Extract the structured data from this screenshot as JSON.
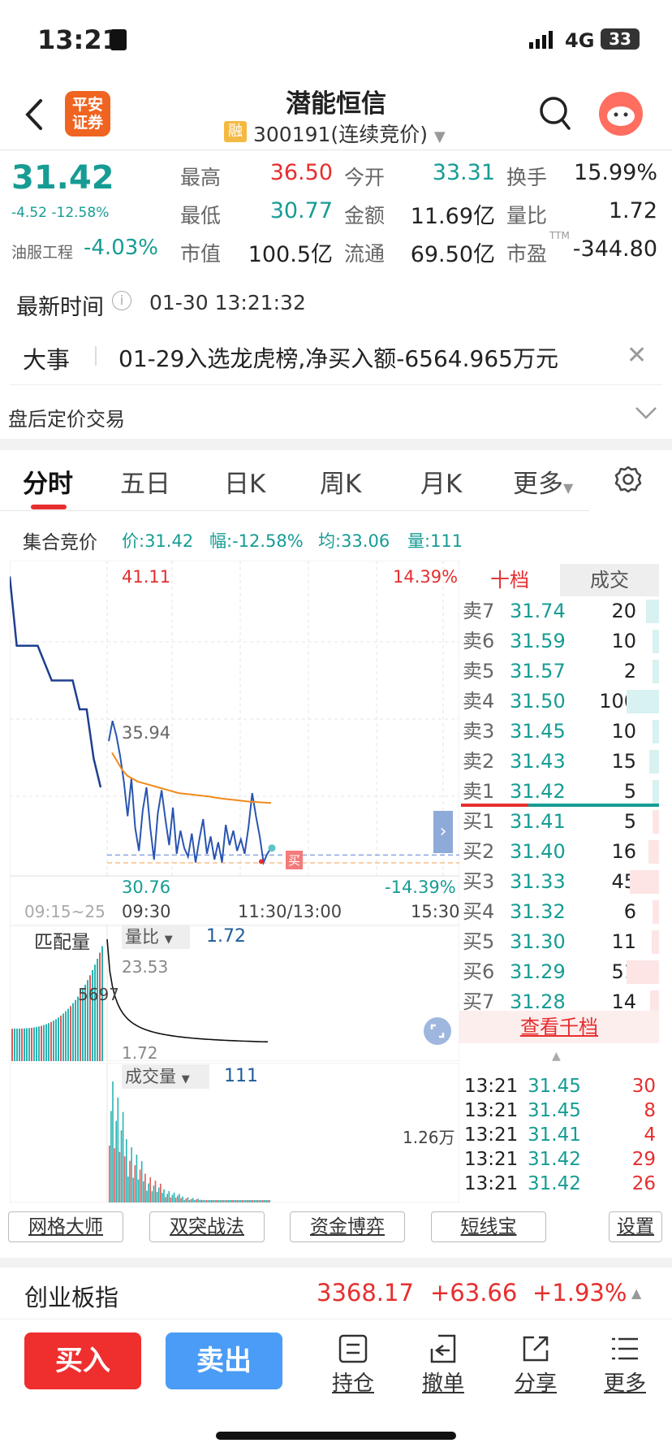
{
  "status": {
    "time": "13:21",
    "network": "4G",
    "battery": "33"
  },
  "header": {
    "title": "潜能恒信",
    "code_label": "300191(连续竞价)",
    "rong": "融",
    "broker_logo": "平安\n证券"
  },
  "quote": {
    "price": "31.42",
    "change": "-4.52 -12.58%",
    "industry_name": "油服工程",
    "industry_change": "-4.03%",
    "fields": [
      {
        "label": "最高",
        "value": "36.50",
        "color": "red"
      },
      {
        "label": "今开",
        "value": "33.31",
        "color": "green"
      },
      {
        "label": "换手",
        "value": "15.99%",
        "color": "black"
      },
      {
        "label": "最低",
        "value": "30.77",
        "color": "green"
      },
      {
        "label": "金额",
        "value": "11.69亿",
        "color": "black"
      },
      {
        "label": "量比",
        "value": "1.72",
        "color": "black"
      },
      {
        "label": "市值",
        "value": "100.5亿",
        "color": "black"
      },
      {
        "label": "流通",
        "value": "69.50亿",
        "color": "black"
      },
      {
        "label": "市盈",
        "value": "-344.80",
        "color": "black"
      }
    ],
    "ttm": "TTM"
  },
  "time_row": {
    "label": "最新时间",
    "value": "01-30 13:21:32"
  },
  "event": {
    "label": "大事",
    "text": "01-29入选龙虎榜,净买入额-6564.965万元"
  },
  "after_hours": {
    "label": "盘后定价交易"
  },
  "tabs": [
    "分时",
    "五日",
    "日K",
    "周K",
    "月K",
    "更多"
  ],
  "info_line": {
    "title": "集合竞价",
    "price": "价:31.42",
    "change": "幅:-12.58%",
    "avg": "均:33.06",
    "vol": "量:111"
  },
  "chart": {
    "max_price": "41.11",
    "max_pct": "14.39%",
    "min_price": "30.76",
    "min_pct": "-14.39%",
    "mid_price": "35.94",
    "buy_tag": "买",
    "x_labels": [
      "09:15~25",
      "09:30",
      "11:30/13:00",
      "15:30"
    ],
    "price_line": [
      35.2,
      35.9,
      35.4,
      34.7,
      33.8,
      32.6,
      33.9,
      32.2,
      31.4,
      32.8,
      33.6,
      32.2,
      31.1,
      32.7,
      33.5,
      32.5,
      31.6,
      32.9,
      31.3,
      32.1,
      31.5,
      31.2,
      32.0,
      31.0,
      31.8,
      32.5,
      31.3,
      31.9,
      31.1,
      31.7,
      31.0,
      32.3,
      31.6,
      32.1,
      31.4,
      31.8,
      31.3,
      32.2,
      33.4,
      32.6,
      31.9,
      31.0,
      31.3,
      31.5
    ],
    "avg_line": [
      34.8,
      34.5,
      34.2,
      34.0,
      33.9,
      33.8,
      33.75,
      33.7,
      33.65,
      33.6,
      33.55,
      33.5,
      33.45,
      33.4,
      33.38,
      33.36,
      33.34,
      33.32,
      33.3,
      33.28,
      33.25,
      33.22,
      33.2,
      33.18,
      33.16,
      33.14,
      33.12,
      33.1,
      33.09,
      33.08,
      33.07,
      33.06
    ],
    "auction_line": [
      40.9,
      38.5,
      38.5,
      38.5,
      38.5,
      37.9,
      37.3,
      37.3,
      37.3,
      37.3,
      36.3,
      36.3,
      34.6,
      33.6
    ]
  },
  "volume": {
    "match_title": "匹配量",
    "match_value": "5697",
    "ratio_label": "量比",
    "ratio_value": "1.72",
    "ratio_max": "23.53",
    "ratio_min": "1.72",
    "vol_label": "成交量",
    "vol_value": "111",
    "vol_max": "1.26万"
  },
  "orderbook": {
    "tab_levels": "十档",
    "tab_trades": "成交",
    "sells": [
      {
        "label": "卖7",
        "price": "31.74",
        "qty": "20"
      },
      {
        "label": "卖6",
        "price": "31.59",
        "qty": "10"
      },
      {
        "label": "卖5",
        "price": "31.57",
        "qty": "2"
      },
      {
        "label": "卖4",
        "price": "31.50",
        "qty": "100"
      },
      {
        "label": "卖3",
        "price": "31.45",
        "qty": "10"
      },
      {
        "label": "卖2",
        "price": "31.43",
        "qty": "15"
      },
      {
        "label": "卖1",
        "price": "31.42",
        "qty": "5"
      }
    ],
    "buys": [
      {
        "label": "买1",
        "price": "31.41",
        "qty": "5"
      },
      {
        "label": "买2",
        "price": "31.40",
        "qty": "16"
      },
      {
        "label": "买3",
        "price": "31.33",
        "qty": "45"
      },
      {
        "label": "买4",
        "price": "31.32",
        "qty": "6"
      },
      {
        "label": "买5",
        "price": "31.30",
        "qty": "11"
      },
      {
        "label": "买6",
        "price": "31.29",
        "qty": "51"
      },
      {
        "label": "买7",
        "price": "31.28",
        "qty": "14"
      }
    ],
    "view_all": "查看千档",
    "trades": [
      {
        "time": "13:21",
        "price": "31.45",
        "qty": "30"
      },
      {
        "time": "13:21",
        "price": "31.45",
        "qty": "8"
      },
      {
        "time": "13:21",
        "price": "31.41",
        "qty": "4"
      },
      {
        "time": "13:21",
        "price": "31.42",
        "qty": "29"
      },
      {
        "time": "13:21",
        "price": "31.42",
        "qty": "26"
      }
    ]
  },
  "tools": [
    "网格大师",
    "双突战法",
    "资金博弈",
    "短线宝",
    "设置"
  ],
  "index_bar": {
    "name": "创业板指",
    "value": "3368.17",
    "change": "+63.66",
    "pct": "+1.93%"
  },
  "bottom": {
    "buy": "买入",
    "sell": "卖出",
    "items": [
      "持仓",
      "撤单",
      "分享",
      "更多"
    ]
  }
}
